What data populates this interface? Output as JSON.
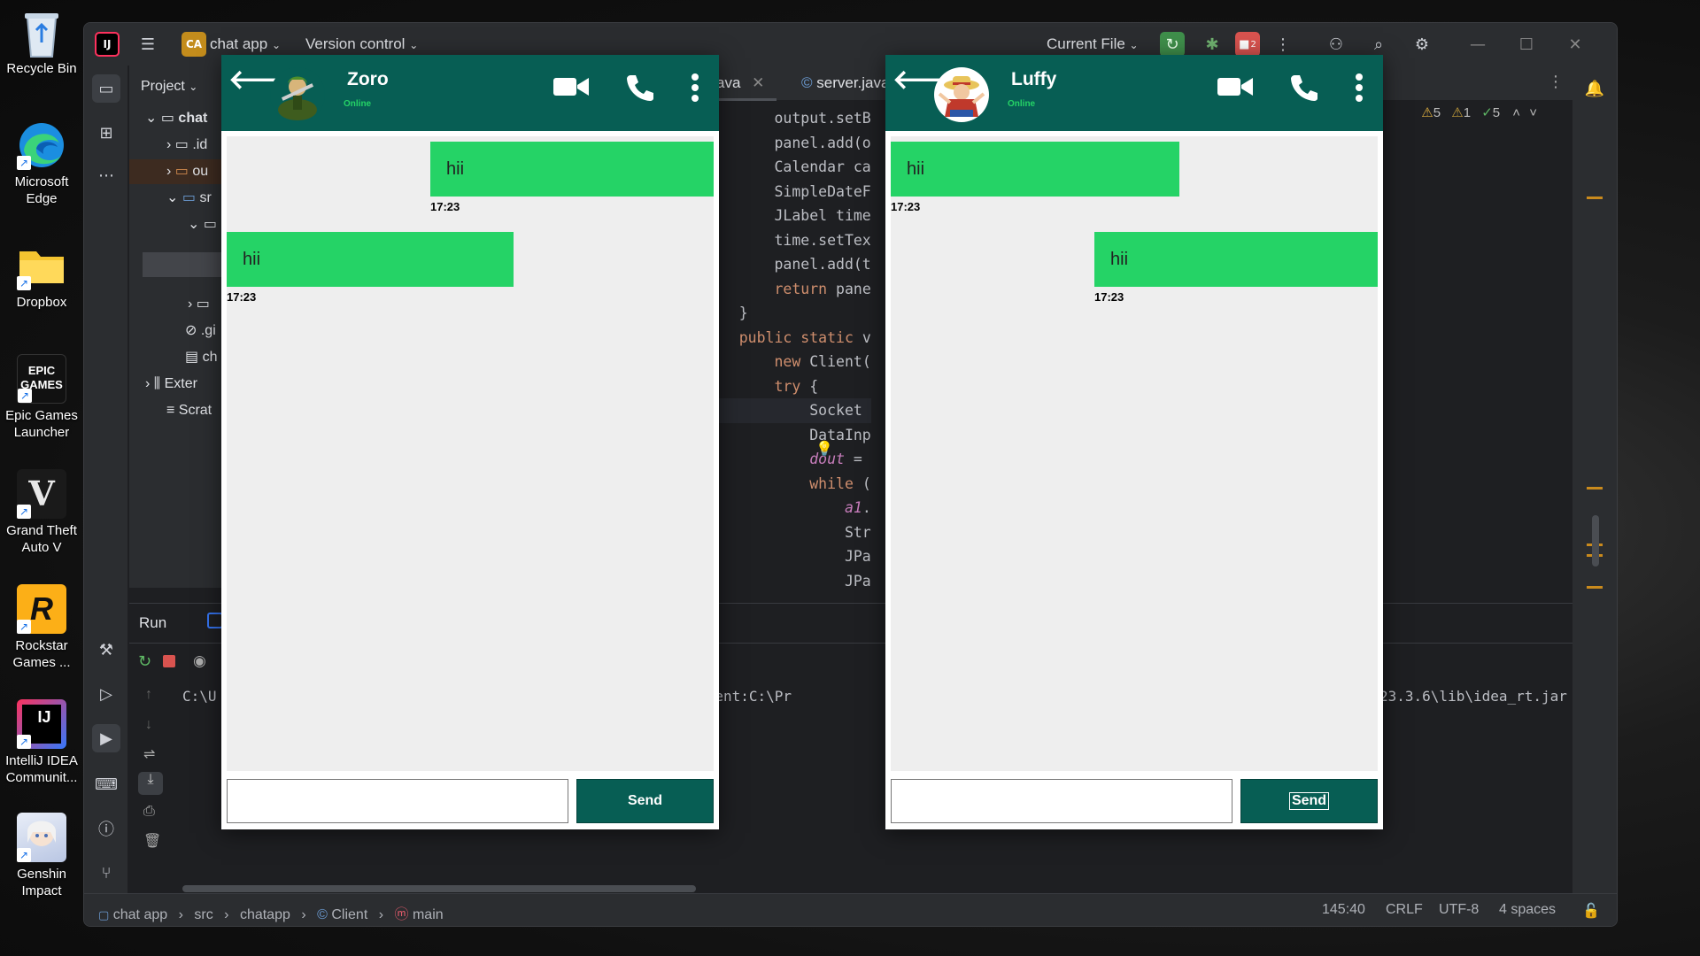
{
  "desktop": {
    "icons": [
      {
        "label": "Recycle Bin"
      },
      {
        "label": "Microsoft Edge"
      },
      {
        "label": "Dropbox"
      },
      {
        "label": "Epic Games Launcher",
        "inner": "EPIC GAMES"
      },
      {
        "label": "Grand Theft Auto V",
        "inner": "V"
      },
      {
        "label": "Rockstar Games ...",
        "inner": "R"
      },
      {
        "label": "IntelliJ IDEA Communit...",
        "inner": "IJ"
      },
      {
        "label": "Genshin Impact"
      }
    ]
  },
  "ide": {
    "logo": "IJ",
    "project_badge": "CA",
    "project_name": "chat app",
    "vcs_menu": "Version control",
    "run_config": "Current File",
    "stop_badge": "2",
    "project_pane_title": "Project",
    "tree": [
      {
        "label": "chat"
      },
      {
        "label": ".id"
      },
      {
        "label": "ou"
      },
      {
        "label": "sr"
      },
      {
        "label": ""
      },
      {
        "label": ""
      },
      {
        "label": ".gi"
      },
      {
        "label": "ch"
      },
      {
        "label": "Exter"
      },
      {
        "label": "Scrat"
      }
    ],
    "tabs": [
      {
        "label": "ava"
      },
      {
        "label": "server.java"
      }
    ],
    "inspections": {
      "warnings": "5",
      "weak_warnings": "1",
      "ok": "5"
    },
    "code_lines": [
      "        output.setB",
      "        panel.add(o",
      "        Calendar ca",
      "        SimpleDateF",
      "        JLabel time",
      "        time.setTex",
      "        panel.add(t",
      "        return pane",
      "    }",
      "    public static v",
      "        new Client(",
      "        try {",
      "            Socket ",
      "            DataInp",
      "            dout = ",
      "            while (",
      "                a1.",
      "                Str",
      "                JPa",
      "                JPa"
    ],
    "run_title": "Run",
    "console_left": "C:\\U",
    "console_mid": "w \"-javaagent:C:\\Pr",
    "console_right": "23.3.6\\lib\\idea_rt.jar",
    "status_bar": {
      "breadcrumbs": [
        "chat app",
        "src",
        "chatapp",
        "Client",
        "main"
      ],
      "position": "145:40",
      "line_sep": "CRLF",
      "encoding": "UTF-8",
      "indent": "4 spaces"
    }
  },
  "chats": [
    {
      "name": "Zoro",
      "status": "Online",
      "messages": [
        {
          "text": "hii",
          "time": "17:23",
          "side": "right"
        },
        {
          "text": "hii",
          "time": "17:23",
          "side": "left"
        }
      ],
      "input_value": "",
      "send_label": "Send"
    },
    {
      "name": "Luffy",
      "status": "Online",
      "messages": [
        {
          "text": "hii",
          "time": "17:23",
          "side": "left"
        },
        {
          "text": "hii",
          "time": "17:23",
          "side": "right"
        }
      ],
      "input_value": "",
      "send_label": "Send"
    }
  ],
  "colors": {
    "chat_header": "#075e54",
    "bubble": "#25d366",
    "online": "#25d366",
    "ide_bg": "#1e1f22",
    "ide_panel": "#2b2d30"
  }
}
